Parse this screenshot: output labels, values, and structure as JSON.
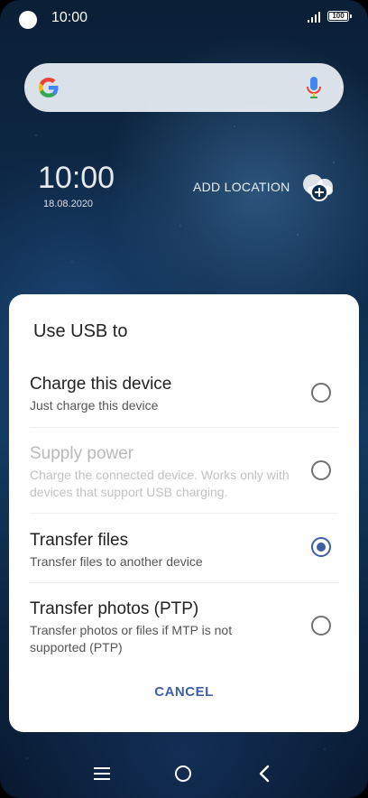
{
  "status_bar": {
    "time": "10:00",
    "battery": "100"
  },
  "home": {
    "clock": "10:00",
    "date": "18.08.2020",
    "add_location": "ADD LOCATION"
  },
  "dialog": {
    "title": "Use USB to",
    "options": [
      {
        "title": "Charge this device",
        "subtitle": "Just charge this device",
        "selected": false,
        "enabled": true
      },
      {
        "title": "Supply power",
        "subtitle": "Charge the connected device. Works only with devices that support USB charging.",
        "selected": false,
        "enabled": false
      },
      {
        "title": "Transfer files",
        "subtitle": "Transfer files to another device",
        "selected": true,
        "enabled": true
      },
      {
        "title": "Transfer photos (PTP)",
        "subtitle": "Transfer photos or files if MTP is not supported (PTP)",
        "selected": false,
        "enabled": true
      }
    ],
    "cancel_label": "CANCEL"
  },
  "icons": {
    "camera": "camera-icon",
    "signal": "signal-icon",
    "battery": "battery-icon",
    "google": "google-icon",
    "mic": "mic-icon",
    "location": "add-location-icon",
    "nav_menu": "menu-icon",
    "nav_home": "home-icon",
    "nav_back": "back-icon"
  },
  "colors": {
    "accent": "#3f5ea8"
  }
}
